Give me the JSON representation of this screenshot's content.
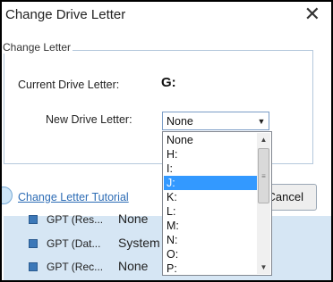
{
  "dialog": {
    "title": "Change Drive Letter",
    "close_glyph": "✕",
    "group_title": "Change Letter",
    "current_label": "Current Drive Letter:",
    "current_value": "G:",
    "new_label": "New Drive Letter:",
    "selected_value": "None",
    "dropdown_arrow": "▼",
    "tutorial_link": "Change Letter Tutorial",
    "cancel_label": "Cancel",
    "options": [
      "None",
      "H:",
      "I:",
      "J:",
      "K:",
      "L:",
      "M:",
      "N:",
      "O:",
      "P:"
    ],
    "highlighted_option": "J:"
  },
  "scrollbar": {
    "up": "▲",
    "down": "▼",
    "grip": "≡"
  },
  "background_list": {
    "rows": [
      {
        "name": "GPT (Res...",
        "filesystem": "None"
      },
      {
        "name": "GPT (Dat...",
        "filesystem": "System"
      },
      {
        "name": "GPT (Rec...",
        "filesystem": "None"
      }
    ]
  },
  "colors": {
    "accent": "#3399ff",
    "link": "#2d6cb5",
    "partition": "#3c78b8"
  }
}
